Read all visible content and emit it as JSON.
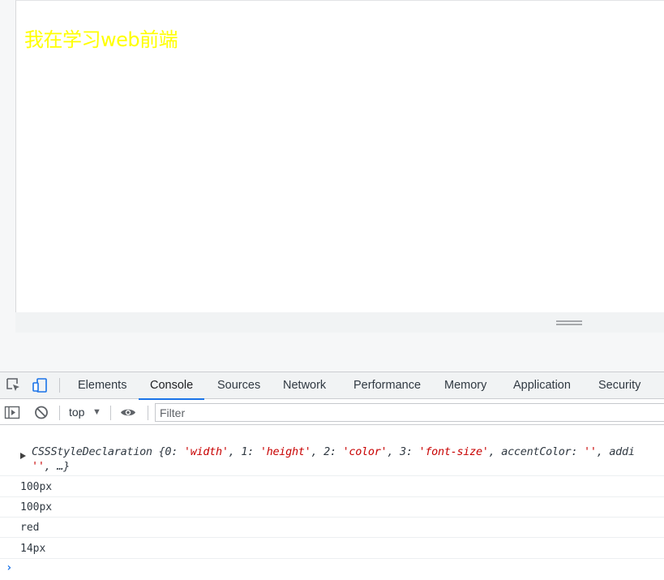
{
  "page": {
    "demo_text": "我在学习web前端"
  },
  "devtools": {
    "tabs": [
      {
        "label": "Elements"
      },
      {
        "label": "Console"
      },
      {
        "label": "Sources"
      },
      {
        "label": "Network"
      },
      {
        "label": "Performance"
      },
      {
        "label": "Memory"
      },
      {
        "label": "Application"
      },
      {
        "label": "Security"
      }
    ],
    "active_tab": "Console",
    "accent_color": "#1a73e8",
    "toolbar": {
      "context": "top",
      "filter_placeholder": "Filter"
    },
    "icons": [
      "inspect-element-icon",
      "device-toolbar-icon",
      "show-sidebar-icon",
      "clear-console-icon",
      "live-expression-eye-icon"
    ]
  },
  "console": {
    "object_log": {
      "type_name": "CSSStyleDeclaration",
      "open": " {",
      "k0": "0: ",
      "v0": "'width'",
      "k1": ", 1: ",
      "v1": "'height'",
      "k2": ", 2: ",
      "v2": "'color'",
      "k3": ", 3: ",
      "v3": "'font-size'",
      "k4": ", accentColor: ",
      "v4": "''",
      "k5": ", addi",
      "line2_str": "''",
      "line2_rest": ", …}"
    },
    "logs": [
      "100px",
      "100px",
      "red",
      "14px"
    ],
    "prompt": "›"
  }
}
